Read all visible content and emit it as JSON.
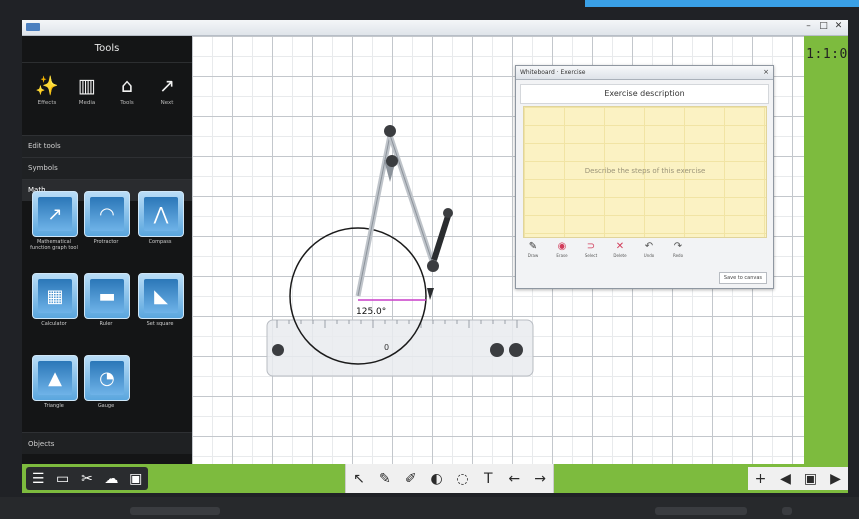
{
  "page_counter": "1:1:0",
  "sidebar": {
    "title": "Tools",
    "top_tools": [
      {
        "icon": "magic-wand-icon",
        "glyph": "✨",
        "label": "Effects"
      },
      {
        "icon": "book-icon",
        "glyph": "▥",
        "label": "Media"
      },
      {
        "icon": "toolbox-icon",
        "glyph": "⌂",
        "label": "Tools"
      },
      {
        "icon": "export-icon",
        "glyph": "↗",
        "label": "Next"
      }
    ],
    "sections": [
      "Edit tools",
      "Symbols",
      "Math"
    ],
    "tiles": [
      {
        "name": "graph-tool-tile",
        "icon": "graph-icon",
        "glyph": "↗",
        "label": "Mathematical function graph tool"
      },
      {
        "name": "protractor-tool-tile",
        "icon": "protractor-icon",
        "glyph": "◠",
        "label": "Protractor"
      },
      {
        "name": "compass-tool-tile",
        "icon": "compass-icon",
        "glyph": "⋀",
        "label": "Compass"
      },
      {
        "name": "calculator-tile",
        "icon": "calculator-icon",
        "glyph": "▦",
        "label": "Calculator"
      },
      {
        "name": "ruler-tile",
        "icon": "ruler-icon",
        "glyph": "▬",
        "label": "Ruler"
      },
      {
        "name": "set-square-tile",
        "icon": "set-square-icon",
        "glyph": "◣",
        "label": "Set square"
      },
      {
        "name": "triangle-tile",
        "icon": "triangle-icon",
        "glyph": "▲",
        "label": "Triangle"
      },
      {
        "name": "gauge-tile",
        "icon": "gauge-icon",
        "glyph": "◔",
        "label": "Gauge"
      }
    ],
    "bottom_section": "Objects"
  },
  "dialog": {
    "title": "Whiteboard · Exercise",
    "close": "×",
    "header": "Exercise description",
    "placeholder": "Describe the steps of this exercise",
    "tools": [
      {
        "icon": "pen-icon",
        "glyph": "✎",
        "label": "Draw"
      },
      {
        "icon": "eraser-icon",
        "glyph": "◉",
        "label": "Erase"
      },
      {
        "icon": "lasso-icon",
        "glyph": "⊃",
        "label": "Select"
      },
      {
        "icon": "delete-icon",
        "glyph": "✕",
        "label": "Delete"
      },
      {
        "icon": "undo-icon",
        "glyph": "↶",
        "label": "Undo"
      },
      {
        "icon": "redo-icon",
        "glyph": "↷",
        "label": "Redo"
      }
    ],
    "footer_button": "Save to canvas"
  },
  "canvas": {
    "measurement": "125.0°",
    "ruler_label": "0"
  },
  "bottombar": {
    "left_tools": [
      {
        "icon": "menu-icon",
        "glyph": "☰"
      },
      {
        "icon": "monitor-icon",
        "glyph": "▭"
      },
      {
        "icon": "tools-icon",
        "glyph": "✂"
      },
      {
        "icon": "cloud-icon",
        "glyph": "☁"
      },
      {
        "icon": "image-icon",
        "glyph": "▣"
      }
    ],
    "center_tools": [
      {
        "icon": "select-arrow-icon",
        "glyph": "↖"
      },
      {
        "icon": "pen-icon",
        "glyph": "✎"
      },
      {
        "icon": "highlighter-icon",
        "glyph": "✐"
      },
      {
        "icon": "shape-fill-icon",
        "glyph": "◐"
      },
      {
        "icon": "eraser-icon",
        "glyph": "◌"
      },
      {
        "icon": "text-icon",
        "glyph": "T"
      },
      {
        "icon": "undo-icon",
        "glyph": "←"
      },
      {
        "icon": "redo-icon",
        "glyph": "→"
      }
    ],
    "right_tools": [
      {
        "icon": "add-page-icon",
        "glyph": "+"
      },
      {
        "icon": "prev-page-icon",
        "glyph": "◀"
      },
      {
        "icon": "page-view-icon",
        "glyph": "▣"
      },
      {
        "icon": "next-page-icon",
        "glyph": "▶"
      }
    ]
  },
  "colors": {
    "accent_green": "#7dbb3e",
    "tile_blue": "#5aa6de",
    "note_yellow": "#fbf2c3",
    "sidebar_dark": "#141516",
    "measure_line": "#c93ec9"
  }
}
